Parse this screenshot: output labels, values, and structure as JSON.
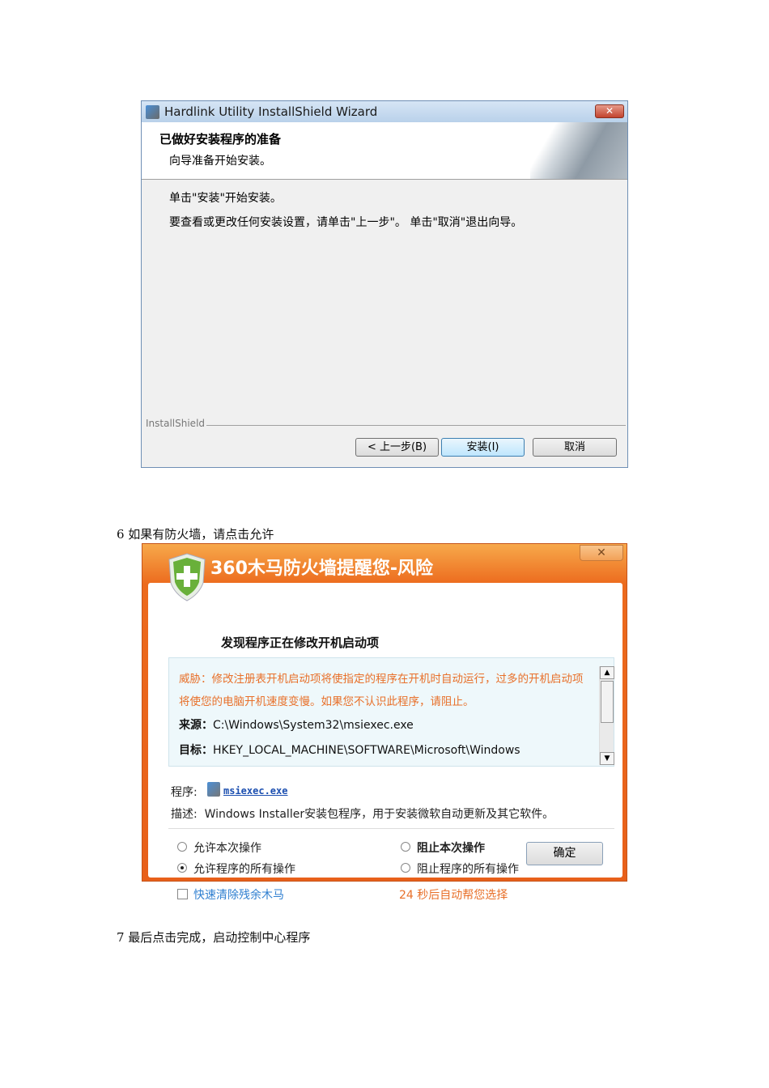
{
  "installer": {
    "title": "Hardlink Utility InstallShield Wizard",
    "close": "✕",
    "heading": "已做好安装程序的准备",
    "subheading": "向导准备开始安装。",
    "body_line1": "单击\"安装\"开始安装。",
    "body_line2": "要查看或更改任何安装设置，请单击\"上一步\"。 单击\"取消\"退出向导。",
    "brand": "InstallShield",
    "back_label": "< 上一步(B)",
    "install_label": "安装(I)",
    "cancel_label": "取消"
  },
  "step6": "6 如果有防火墙，请点击允许",
  "firewall": {
    "close": "✕",
    "title": "360木马防火墙提醒您-风险",
    "subtitle": "发现程序正在修改开机启动项",
    "threat": "威胁：修改注册表开机启动项将使指定的程序在开机时自动运行，过多的开机启动项将使您的电脑开机速度变慢。如果您不认识此程序，请阻止。",
    "source_label": "来源：",
    "source_value": "C:\\Windows\\System32\\msiexec.exe",
    "target_label": "目标：",
    "target_value": "HKEY_LOCAL_MACHINE\\SOFTWARE\\Microsoft\\Windows",
    "program_label": "程序:",
    "program_link": "msiexec.exe",
    "desc_label": "描述:",
    "desc_value": "Windows Installer安装包程序，用于安装微软自动更新及其它软件。",
    "options": {
      "allow_once": "允许本次操作",
      "allow_all": "允许程序的所有操作",
      "block_once": "阻止本次操作",
      "block_all": "阻止程序的所有操作"
    },
    "selected_option": "allow_all",
    "quick_clean": "快速清除残余木马",
    "countdown": "24 秒后自动帮您选择",
    "ok_label": "确定"
  },
  "step7": "7 最后点击完成，启动控制中心程序"
}
